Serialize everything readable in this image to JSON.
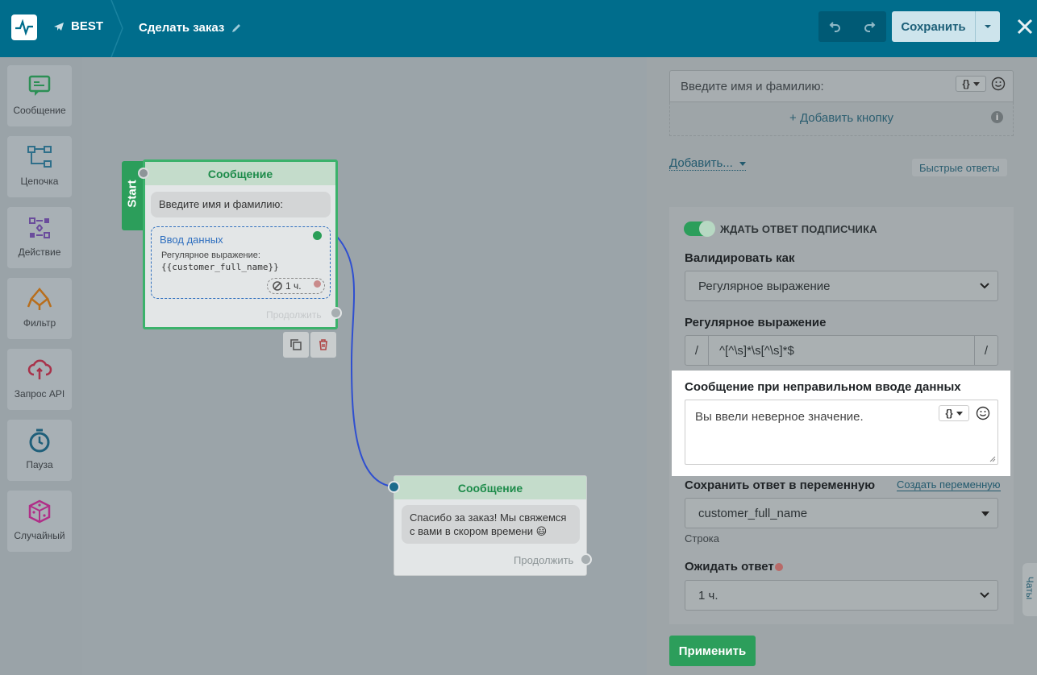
{
  "header": {
    "project": "BEST",
    "flow_title": "Сделать заказ",
    "save_label": "Сохранить"
  },
  "toolbar": {
    "items": [
      {
        "label": "Сообщение",
        "icon": "message-icon"
      },
      {
        "label": "Цепочка",
        "icon": "chain-icon"
      },
      {
        "label": "Действие",
        "icon": "action-icon"
      },
      {
        "label": "Фильтр",
        "icon": "filter-icon"
      },
      {
        "label": "Запрос API",
        "icon": "api-request-icon"
      },
      {
        "label": "Пауза",
        "icon": "pause-icon"
      },
      {
        "label": "Случайный",
        "icon": "random-icon"
      }
    ]
  },
  "canvas": {
    "node1": {
      "start_label": "Start",
      "title": "Сообщение",
      "message": "Введите имя и фамилию:",
      "input_title": "Ввод данных",
      "regex_label": "Регулярное выражение:",
      "regex_value": "{{customer_full_name}}",
      "timer": "1 ч.",
      "continue": "Продолжить"
    },
    "node2": {
      "title": "Сообщение",
      "message": "Спасибо за заказ! Мы свяжемся с вами в скором времени 😃",
      "continue": "Продолжить"
    }
  },
  "panel": {
    "message_text": "Введите имя и фамилию:",
    "add_button": "+ Добавить кнопку",
    "add_more": "Добавить...",
    "quick_replies": "Быстрые ответы",
    "wait_toggle": "ЖДАТЬ ОТВЕТ ПОДПИСЧИКА",
    "validate_label": "Валидировать как",
    "validate_value": "Регулярное выражение",
    "regex_label": "Регулярное выражение",
    "regex_open": "/",
    "regex_value": "^[^\\s]*\\s[^\\s]*$",
    "regex_close": "/",
    "invalid_label": "Сообщение при неправильном вводе данных",
    "invalid_text": "Вы ввели неверное значение.",
    "save_var_label": "Сохранить ответ в переменную",
    "create_var": "Создать переменную",
    "var_value": "customer_full_name",
    "var_type": "Строка",
    "wait_label": "Ожидать ответ",
    "wait_value": "1 ч.",
    "apply": "Применить",
    "chats": "Чаты",
    "var_btn": "{}"
  },
  "colors": {
    "header": "#006d8c",
    "accent_green": "#2c9e5b",
    "link": "#235a6e",
    "connector": "#2f4fd0"
  }
}
